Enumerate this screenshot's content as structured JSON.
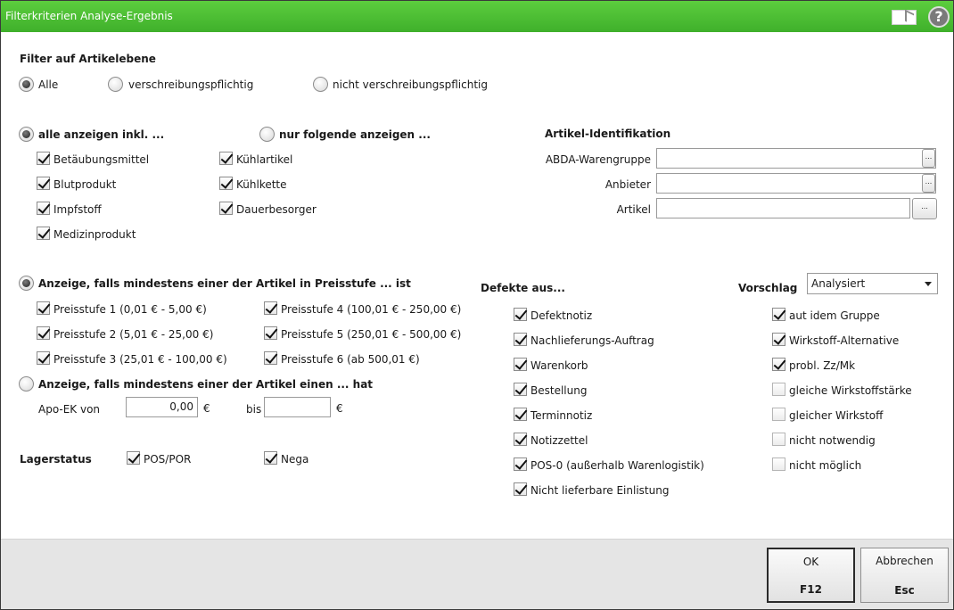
{
  "window": {
    "title": "Filterkriterien Analyse-Ergebnis",
    "icons": [
      "window-icon",
      "help-icon"
    ]
  },
  "help_glyph": "?",
  "article_filter": {
    "heading": "Filter auf Artikelebene",
    "options": [
      "Alle",
      "verschreibungspflichtig",
      "nicht verschreibungspflichtig"
    ],
    "selected": "Alle"
  },
  "display_mode": {
    "all_label": "alle anzeigen inkl. ...",
    "only_label": "nur folgende anzeigen ...",
    "selected": "all",
    "checkboxes": [
      {
        "label": "Betäubungsmittel",
        "checked": true
      },
      {
        "label": "Blutprodukt",
        "checked": true
      },
      {
        "label": "Impfstoff",
        "checked": true
      },
      {
        "label": "Medizinprodukt",
        "checked": true
      },
      {
        "label": "Kühlartikel",
        "checked": true
      },
      {
        "label": "Kühlkette",
        "checked": true
      },
      {
        "label": "Dauerbesorger",
        "checked": true
      }
    ]
  },
  "article_id": {
    "heading": "Artikel-Identifikation",
    "fields": [
      {
        "label": "ABDA-Warengruppe",
        "value": "",
        "button": "..."
      },
      {
        "label": "Anbieter",
        "value": "",
        "button": "..."
      },
      {
        "label": "Artikel",
        "value": "",
        "button": "..."
      }
    ]
  },
  "price_filter": {
    "option1": "Anzeige, falls mindestens einer der Artikel in Preisstufe ... ist",
    "option2": "Anzeige, falls mindestens einer der Artikel einen ... hat",
    "selected": "option1",
    "levels": [
      {
        "label": "Preisstufe 1 (0,01 € - 5,00 €)",
        "checked": true
      },
      {
        "label": "Preisstufe 2 (5,01 € - 25,00 €)",
        "checked": true
      },
      {
        "label": "Preisstufe 3 (25,01 € - 100,00 €)",
        "checked": true
      },
      {
        "label": "Preisstufe 4 (100,01 € - 250,00 €)",
        "checked": true
      },
      {
        "label": "Preisstufe 5 (250,01 € - 500,00 €)",
        "checked": true
      },
      {
        "label": "Preisstufe 6 (ab 500,01 €)",
        "checked": true
      }
    ],
    "ek_from_label": "Apo-EK von",
    "ek_from_value": "0,00",
    "currency": "€",
    "ek_to_label": "bis",
    "ek_to_value": ""
  },
  "stock": {
    "label": "Lagerstatus",
    "items": [
      {
        "label": "POS/POR",
        "checked": true
      },
      {
        "label": "Nega",
        "checked": true
      }
    ]
  },
  "defects": {
    "heading": "Defekte aus...",
    "items": [
      {
        "label": "Defektnotiz",
        "checked": true
      },
      {
        "label": "Nachlieferungs-Auftrag",
        "checked": true
      },
      {
        "label": "Warenkorb",
        "checked": true
      },
      {
        "label": "Bestellung",
        "checked": true
      },
      {
        "label": "Terminnotiz",
        "checked": true
      },
      {
        "label": "Notizzettel",
        "checked": true
      },
      {
        "label": "POS-0 (außerhalb Warenlogistik)",
        "checked": true
      },
      {
        "label": "Nicht lieferbare Einlistung",
        "checked": true
      }
    ]
  },
  "proposal": {
    "label": "Vorschlag",
    "selected": "Analysiert",
    "items": [
      {
        "label": "aut idem Gruppe",
        "checked": true
      },
      {
        "label": "Wirkstoff-Alternative",
        "checked": true
      },
      {
        "label": "probl. Zz/Mk",
        "checked": true
      },
      {
        "label": "gleiche Wirkstoffstärke",
        "checked": false
      },
      {
        "label": "gleicher Wirkstoff",
        "checked": false
      },
      {
        "label": "nicht notwendig",
        "checked": false
      },
      {
        "label": "nicht möglich",
        "checked": false
      }
    ]
  },
  "footer": {
    "ok": {
      "label": "OK",
      "key": "F12"
    },
    "cancel": {
      "label": "Abbrechen",
      "key": "Esc"
    }
  }
}
